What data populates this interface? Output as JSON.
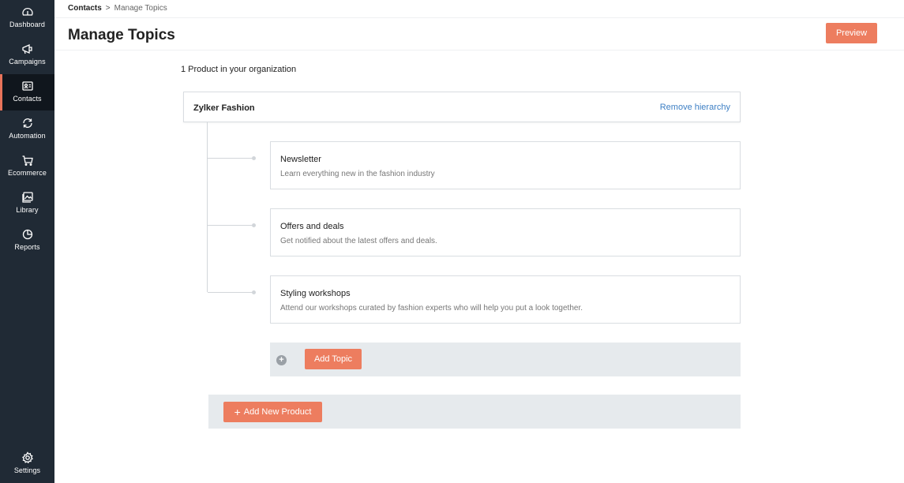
{
  "sidebar": {
    "items": [
      {
        "label": "Dashboard",
        "icon": "dashboard-gauge-icon",
        "active": false
      },
      {
        "label": "Campaigns",
        "icon": "megaphone-icon",
        "active": false
      },
      {
        "label": "Contacts",
        "icon": "contact-card-icon",
        "active": true
      },
      {
        "label": "Automation",
        "icon": "automation-cycle-icon",
        "active": false
      },
      {
        "label": "Ecommerce",
        "icon": "shopping-cart-icon",
        "active": false
      },
      {
        "label": "Library",
        "icon": "image-library-icon",
        "active": false
      },
      {
        "label": "Reports",
        "icon": "pie-chart-icon",
        "active": false
      }
    ],
    "settings": {
      "label": "Settings",
      "icon": "gear-icon"
    }
  },
  "breadcrumb": {
    "parent": "Contacts",
    "separator": ">",
    "current": "Manage Topics"
  },
  "header": {
    "title": "Manage Topics",
    "preview_label": "Preview"
  },
  "org": {
    "count_text": "1 Product in your organization"
  },
  "product": {
    "name": "Zylker Fashion",
    "remove_label": "Remove hierarchy",
    "topics": [
      {
        "title": "Newsletter",
        "description": "Learn everything new in the fashion industry"
      },
      {
        "title": "Offers and deals",
        "description": "Get notified about the latest offers and deals."
      },
      {
        "title": "Styling workshops",
        "description": "Attend our workshops curated by fashion experts who will help you put a look together."
      }
    ],
    "add_topic_label": "Add Topic"
  },
  "add_product_label": "Add New Product",
  "colors": {
    "sidebar_bg": "#202a35",
    "accent": "#ed7d5f",
    "link": "#3d7fc4",
    "bar_bg": "#e6eaed"
  }
}
